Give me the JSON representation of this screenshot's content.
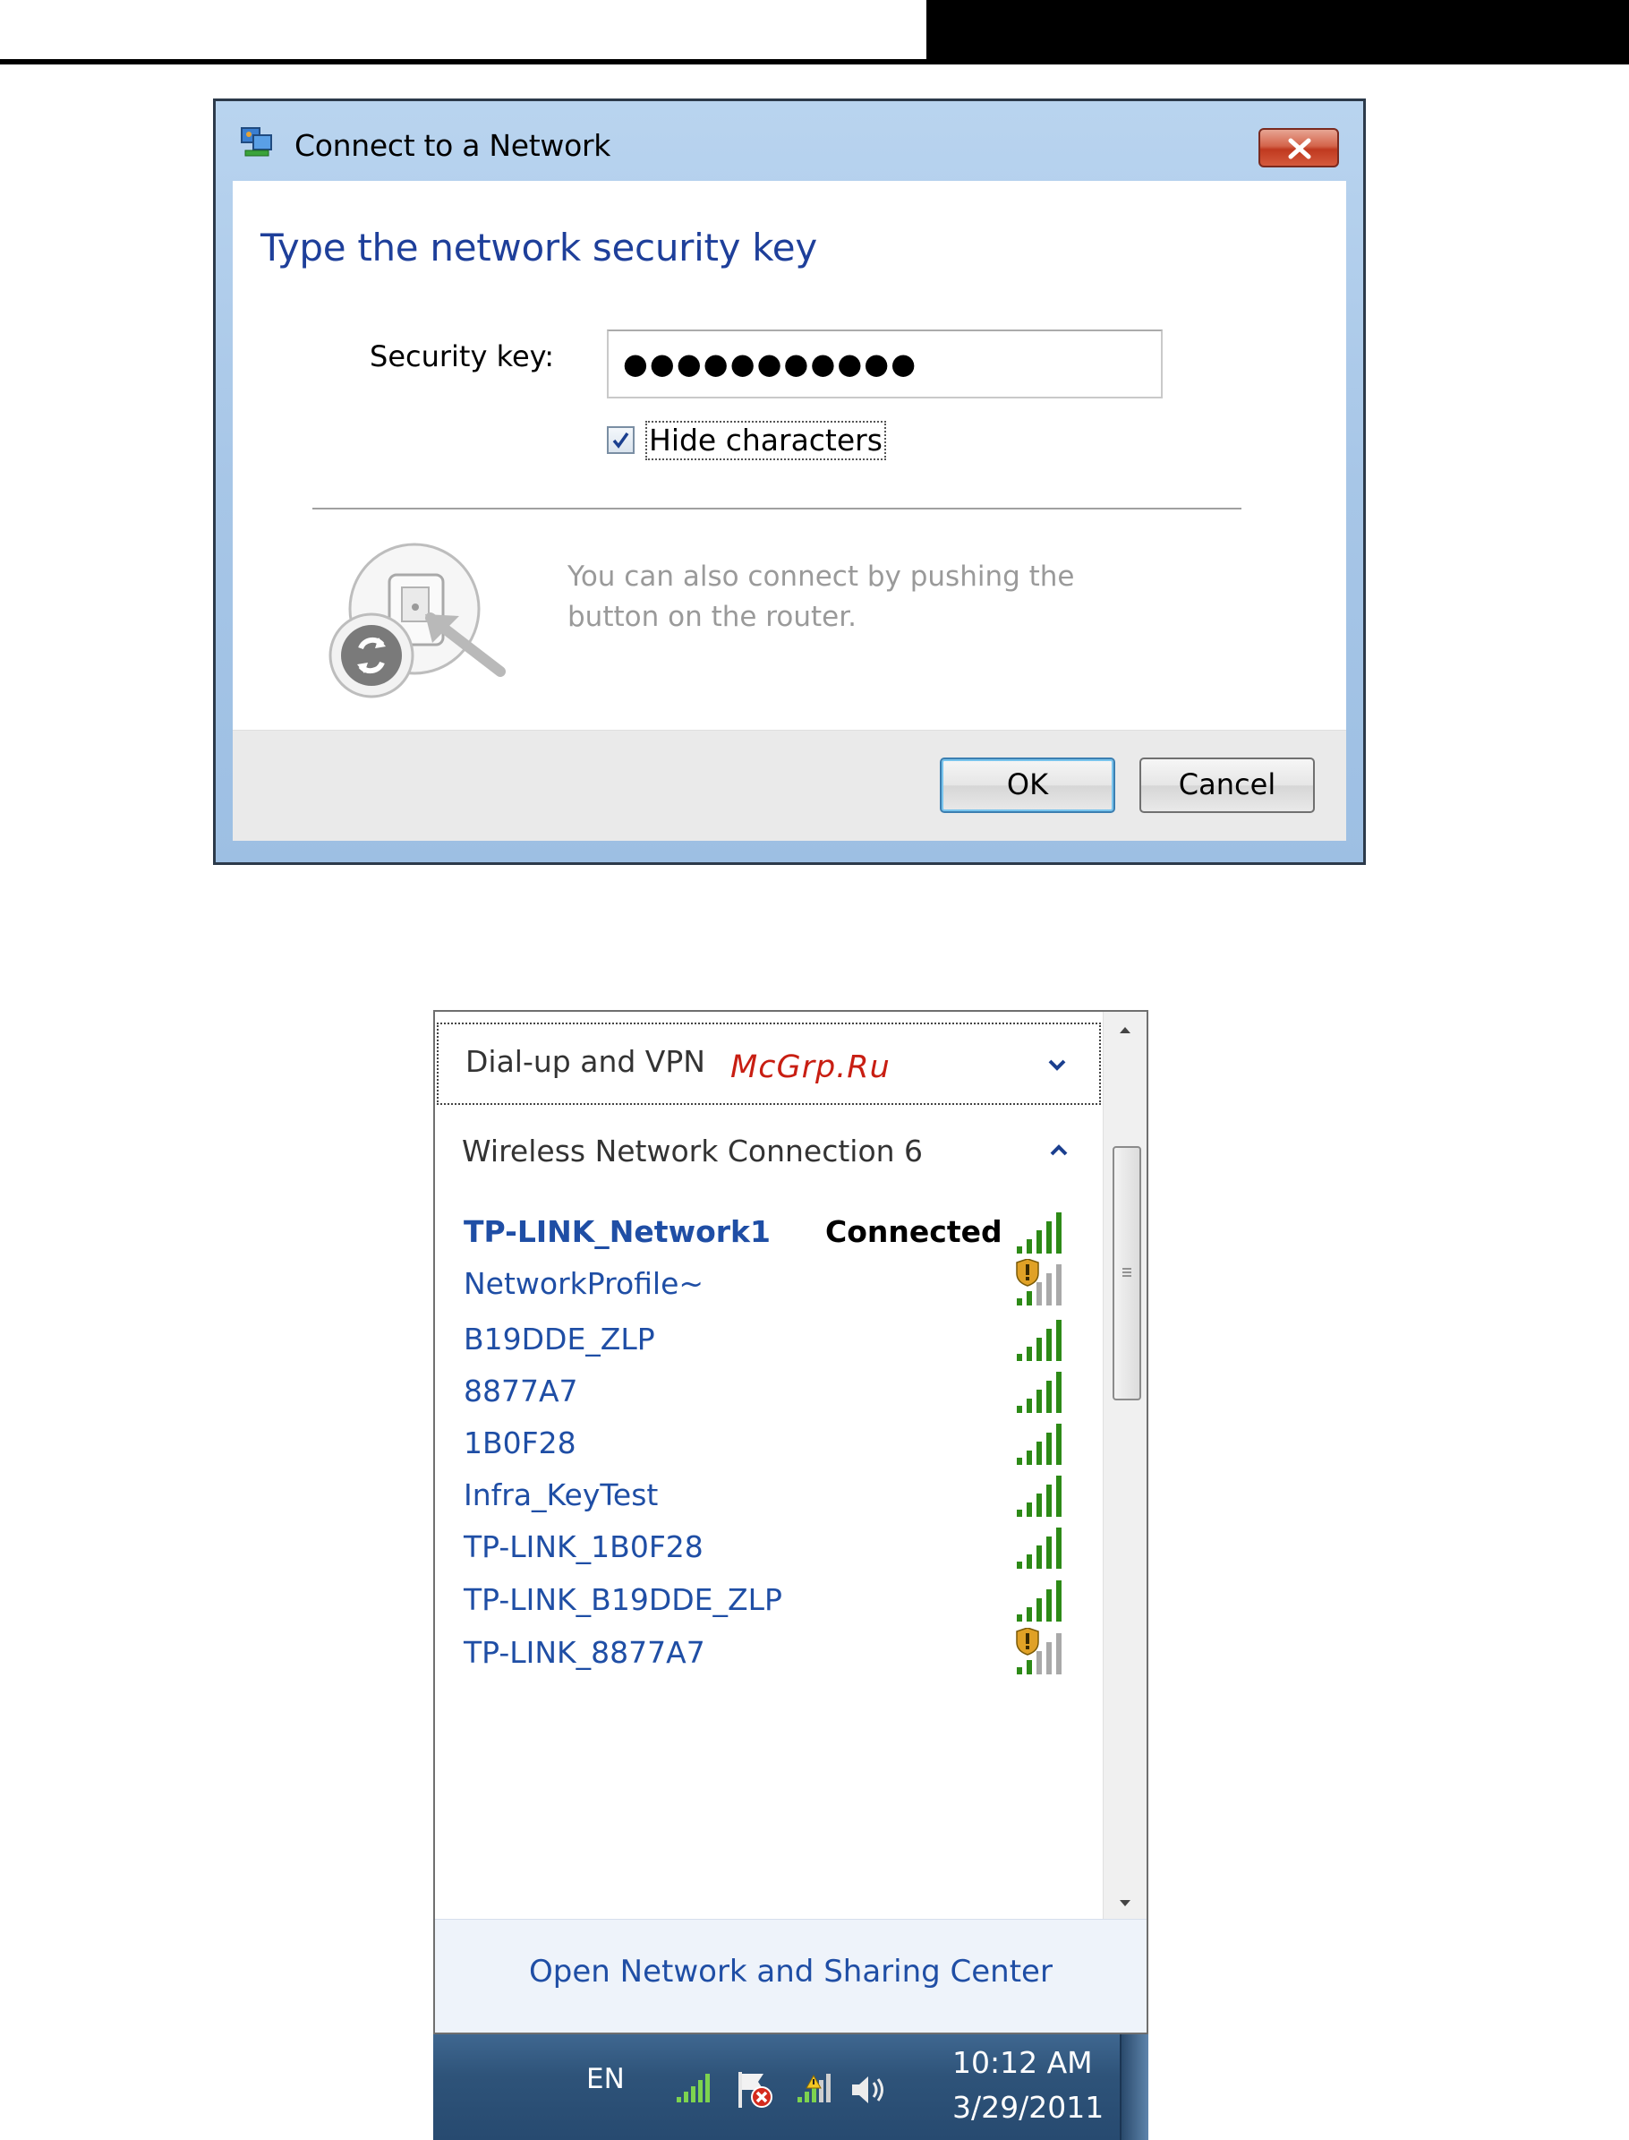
{
  "dialog": {
    "title": "Connect to a Network",
    "heading": "Type the network security key",
    "security_key_label": "Security key:",
    "security_key_value": "●●●●●●●●●●●",
    "hide_characters_label": "Hide characters",
    "hide_characters_checked": true,
    "wps_hint": "You can also connect by pushing the button on the router.",
    "ok_label": "OK",
    "cancel_label": "Cancel"
  },
  "flyout": {
    "dialup_section": "Dial-up and VPN",
    "watermark": "McGrp.Ru",
    "wireless_section": "Wireless Network Connection 6",
    "networks": [
      {
        "name": "TP-LINK_Network1",
        "status": "Connected",
        "secured_warning": false
      },
      {
        "name": "NetworkProfile~",
        "status": "",
        "secured_warning": true
      },
      {
        "name": "B19DDE_ZLP",
        "status": "",
        "secured_warning": false
      },
      {
        "name": "8877A7",
        "status": "",
        "secured_warning": false
      },
      {
        "name": "1B0F28",
        "status": "",
        "secured_warning": false
      },
      {
        "name": "Infra_KeyTest",
        "status": "",
        "secured_warning": false
      },
      {
        "name": "TP-LINK_1B0F28",
        "status": "",
        "secured_warning": false
      },
      {
        "name": "TP-LINK_B19DDE_ZLP",
        "status": "",
        "secured_warning": false
      },
      {
        "name": "TP-LINK_8877A7",
        "status": "",
        "secured_warning": true
      }
    ],
    "footer_link": "Open Network and Sharing Center"
  },
  "taskbar": {
    "language": "EN",
    "time": "10:12 AM",
    "date": "3/29/2011"
  },
  "colors": {
    "link_blue": "#1f4ea5",
    "heading_blue": "#1e3f9a",
    "signal_green": "#2d8a17",
    "close_red": "#c0391f"
  },
  "icons": [
    "network-connect-icon",
    "close-icon",
    "checkmark-icon",
    "wps-router-icon",
    "chevron-down-icon",
    "chevron-up-icon",
    "signal-bars-icon",
    "shield-warning-icon",
    "scroll-up-icon",
    "scroll-down-icon",
    "network-tray-icon",
    "action-center-flag-icon",
    "network-warning-tray-icon",
    "volume-icon"
  ]
}
